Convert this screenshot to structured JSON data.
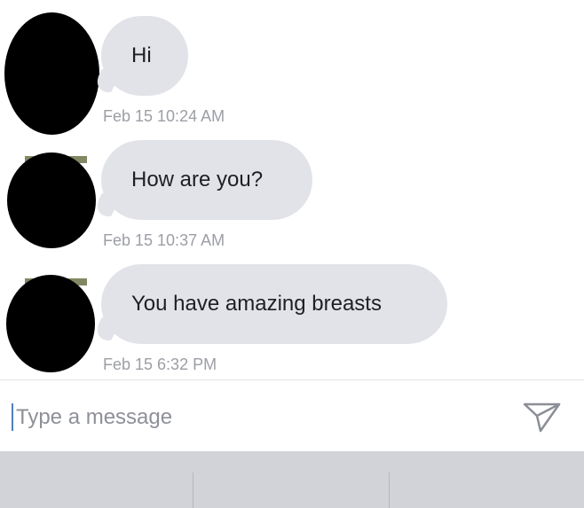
{
  "conversation": {
    "messages": [
      {
        "text": "Hi",
        "timestamp": "Feb 15 10:24 AM"
      },
      {
        "text": "How are you?",
        "timestamp": "Feb 15 10:37 AM"
      },
      {
        "text": "You have amazing breasts",
        "timestamp": "Feb 15 6:32 PM"
      }
    ]
  },
  "composer": {
    "placeholder": "Type a message",
    "send_icon": "paper-plane-icon"
  },
  "colors": {
    "bubble_background": "#e1e3e8",
    "timestamp_text": "#9c9ea5",
    "caret": "#4f7fbd",
    "keyboard_background": "#d1d3d8"
  }
}
